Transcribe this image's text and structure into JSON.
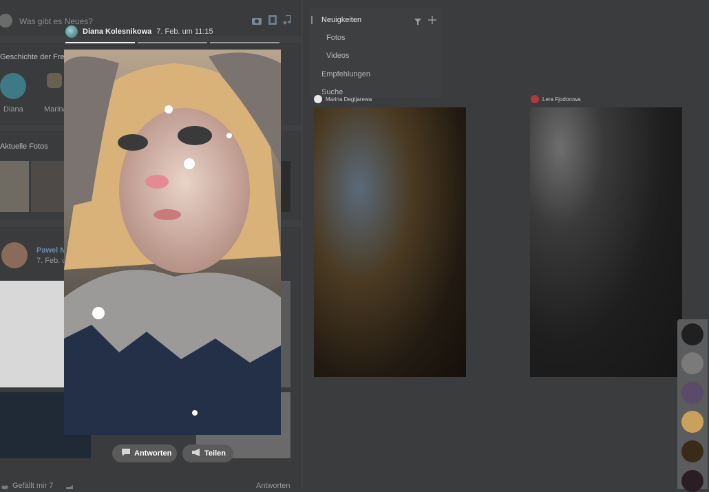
{
  "composer": {
    "placeholder": "Was gibt es Neues?"
  },
  "stories_section": {
    "title": "Geschichte der Freu",
    "items": [
      {
        "name": "Diana"
      },
      {
        "name": "Marina"
      }
    ]
  },
  "photos_section": {
    "title": "Aktuelle Fotos"
  },
  "post": {
    "author": "Pawel N",
    "date": "7. Feb. u",
    "like_label": "Gefällt mir",
    "like_count": "7",
    "reply_label": "Antworten"
  },
  "menu": {
    "items": [
      {
        "label": "Neuigkeiten",
        "active": true
      },
      {
        "label": "Fotos"
      },
      {
        "label": "Videos"
      },
      {
        "label": "Empfehlungen"
      },
      {
        "label": "Suche"
      }
    ]
  },
  "story": {
    "author": "Diana Kolesnikowa",
    "time": "7. Feb. um 11:15",
    "progress": [
      1.0,
      0.0,
      0.0
    ],
    "reply_button": "Antworten",
    "share_button": "Teilen"
  },
  "side_stories": [
    {
      "author": "Marina Degtjarewa"
    },
    {
      "author": "Lera Fjodorowa"
    }
  ],
  "colors": {
    "background": "#3b3c3d",
    "progress_active": "#f4f4f4",
    "progress_inactive": "#9a9a9a",
    "pill": "#5a5a5a"
  }
}
